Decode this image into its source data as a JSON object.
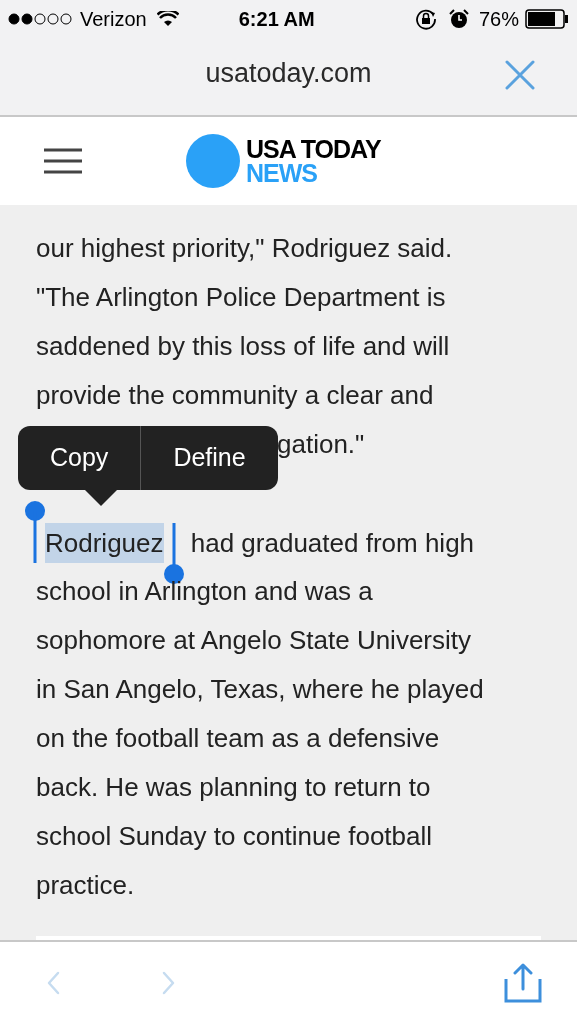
{
  "status_bar": {
    "carrier": "Verizon",
    "time": "6:21 AM",
    "battery": "76%"
  },
  "url_bar": {
    "url": "usatoday.com"
  },
  "site_header": {
    "logo_title": "USA TODAY",
    "logo_section": "NEWS"
  },
  "article": {
    "paragraphs": [
      {
        "lines": [
          "our highest priority,\" Rodriguez said.",
          "\"The Arlington Police Department is",
          "saddened by this loss of life and will",
          "provide the community a clear and"
        ],
        "covered_tail": "gation.\""
      },
      {
        "first_segments": [
          {
            "text": "Rodriguez",
            "selected": true
          },
          {
            "text": " had graduated from high",
            "selected": false
          }
        ],
        "lines": [
          "school in Arlington and was a",
          "sophomore at Angelo State University",
          "in San Angelo, Texas, where he played",
          "on the football team as a defensive",
          "back. He was planning to return to",
          "school Sunday to continue football",
          "practice."
        ]
      }
    ]
  },
  "edit_menu": {
    "items": [
      "Copy",
      "Define"
    ]
  },
  "toolbar": {
    "back": {
      "disabled": true
    },
    "forward": {
      "disabled": true
    }
  }
}
